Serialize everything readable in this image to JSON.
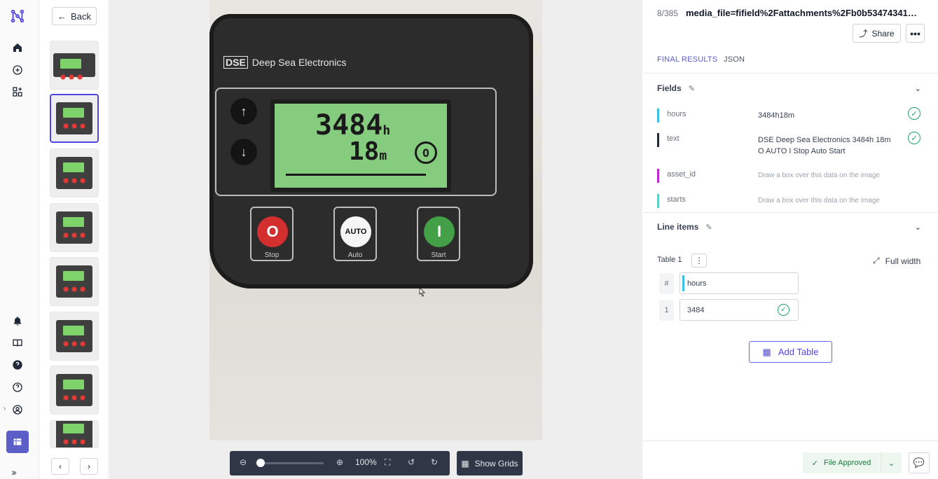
{
  "nav": {
    "icons": [
      "logo-icon",
      "home-icon",
      "add-circle-icon",
      "grid-add-icon",
      "bell-icon",
      "book-icon",
      "help-solid-icon",
      "help-outline-icon",
      "user-circle-icon",
      "table-icon"
    ]
  },
  "thumbs": {
    "back_label": "Back",
    "count": 8,
    "selected_index": 1
  },
  "photo": {
    "brand_short": "DSE",
    "brand_name": "Deep Sea Electronics",
    "lcd_hours": "3484",
    "lcd_hours_unit": "h",
    "lcd_minutes": "18",
    "lcd_minutes_unit": "m",
    "lcd_state": "O",
    "stop_symbol": "O",
    "stop_label": "Stop",
    "auto_symbol": "AUTO",
    "auto_label": "Auto",
    "start_symbol": "I",
    "start_label": "Start"
  },
  "viewer": {
    "zoom": "100%",
    "show_grids_label": "Show Grids"
  },
  "doc": {
    "counter": "8/385",
    "filename": "media_file=fifield%2Fattachments%2Fb0b534743414...",
    "share_label": "Share",
    "more_label": "•••"
  },
  "tabs": [
    {
      "label": "FINAL RESULTS"
    },
    {
      "label": "JSON"
    }
  ],
  "fields_section": {
    "title": "Fields",
    "rows": [
      {
        "name": "hours",
        "value": "3484h18m",
        "color": "#3bc3e4",
        "verified": true
      },
      {
        "name": "text",
        "value": "DSE Deep Sea Electronics 3484h 18m O AUTO I Stop Auto Start",
        "color": "#1f2937",
        "verified": true
      },
      {
        "name": "asset_id",
        "value": "Draw a box over this data on the image",
        "color": "#c026d3",
        "verified": false
      },
      {
        "name": "starts",
        "value": "Draw a box over this data on the image",
        "color": "#5ccfc6",
        "verified": false
      }
    ]
  },
  "line_items": {
    "title": "Line items",
    "table_title": "Table 1",
    "full_width_label": "Full width",
    "header_index": "#",
    "column_header": "hours",
    "rows": [
      {
        "index": "1",
        "value": "3484",
        "verified": true
      }
    ],
    "add_table_label": "Add Table"
  },
  "footer": {
    "approved_label": "File Approved"
  }
}
